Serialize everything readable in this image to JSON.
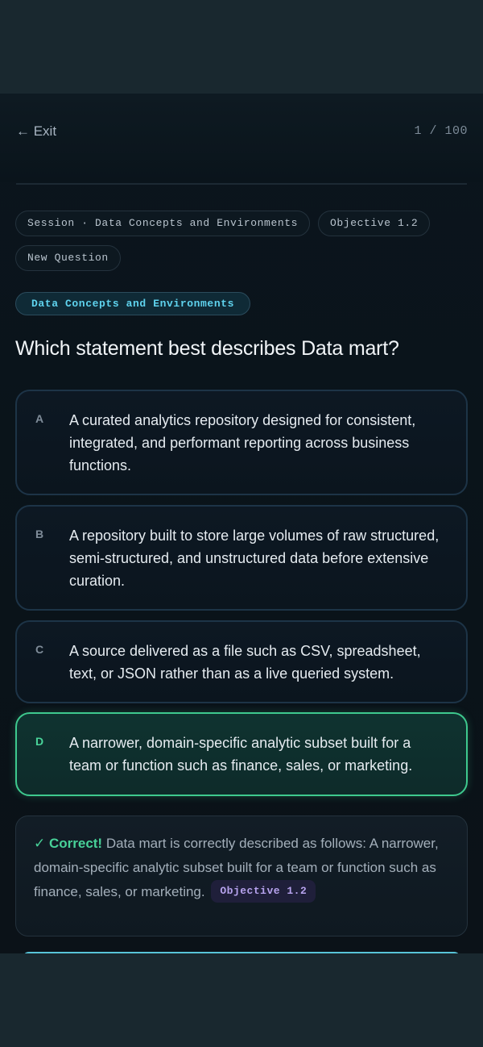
{
  "header": {
    "exit_label": "← Exit",
    "counter": "1 / 100"
  },
  "chips": {
    "session": "Session · Data Concepts and Environments",
    "objective": "Objective 1.2",
    "status": "New Question"
  },
  "topic": "Data Concepts and Environments",
  "question": "Which statement best describes Data mart?",
  "options": [
    {
      "letter": "A",
      "text": "A curated analytics repository designed for consistent, integrated, and performant reporting across business functions."
    },
    {
      "letter": "B",
      "text": "A repository built to store large volumes of raw structured, semi-structured, and unstructured data before extensive curation."
    },
    {
      "letter": "C",
      "text": "A source delivered as a file such as CSV, spreadsheet, text, or JSON rather than as a live queried system."
    },
    {
      "letter": "D",
      "text": "A narrower, domain-specific analytic subset built for a team or function such as finance, sales, or marketing."
    }
  ],
  "selected_option": "D",
  "feedback": {
    "status": "✓ Correct!",
    "message": "Data mart is correctly described as follows: A narrower, domain-specific analytic subset built for a team or function such as finance, sales, or marketing.",
    "objective_badge": "Objective 1.2"
  },
  "colors": {
    "accent": "#5fd3ee",
    "correct": "#3ec98e",
    "background": "#0a141b"
  }
}
